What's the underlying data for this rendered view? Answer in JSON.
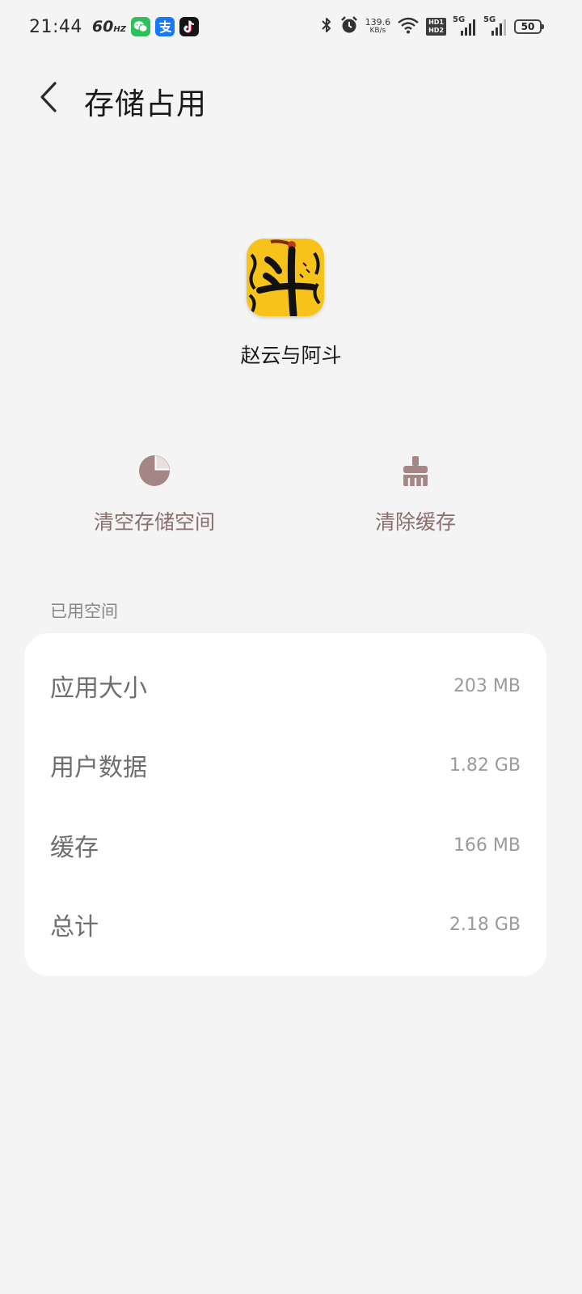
{
  "status_bar": {
    "time": "21:44",
    "refresh_rate": "60",
    "refresh_unit": "HZ",
    "net_speed_value": "139.6",
    "net_speed_unit": "KB/s",
    "hd1": "HD1",
    "hd2": "HD2",
    "sim1_label": "5G",
    "sim2_label": "5G",
    "battery": "50"
  },
  "header": {
    "title": "存储占用"
  },
  "app": {
    "name": "赵云与阿斗"
  },
  "actions": {
    "clear_storage": "清空存储空间",
    "clear_cache": "清除缓存"
  },
  "storage": {
    "section_label": "已用空间",
    "rows": [
      {
        "label": "应用大小",
        "value": "203 MB"
      },
      {
        "label": "用户数据",
        "value": "1.82 GB"
      },
      {
        "label": "缓存",
        "value": "166 MB"
      },
      {
        "label": "总计",
        "value": "2.18 GB"
      }
    ]
  },
  "colors": {
    "background": "#f4f4f4",
    "card": "#ffffff",
    "action_accent": "#8a6e6c",
    "app_icon_yellow": "#f7c31a"
  }
}
